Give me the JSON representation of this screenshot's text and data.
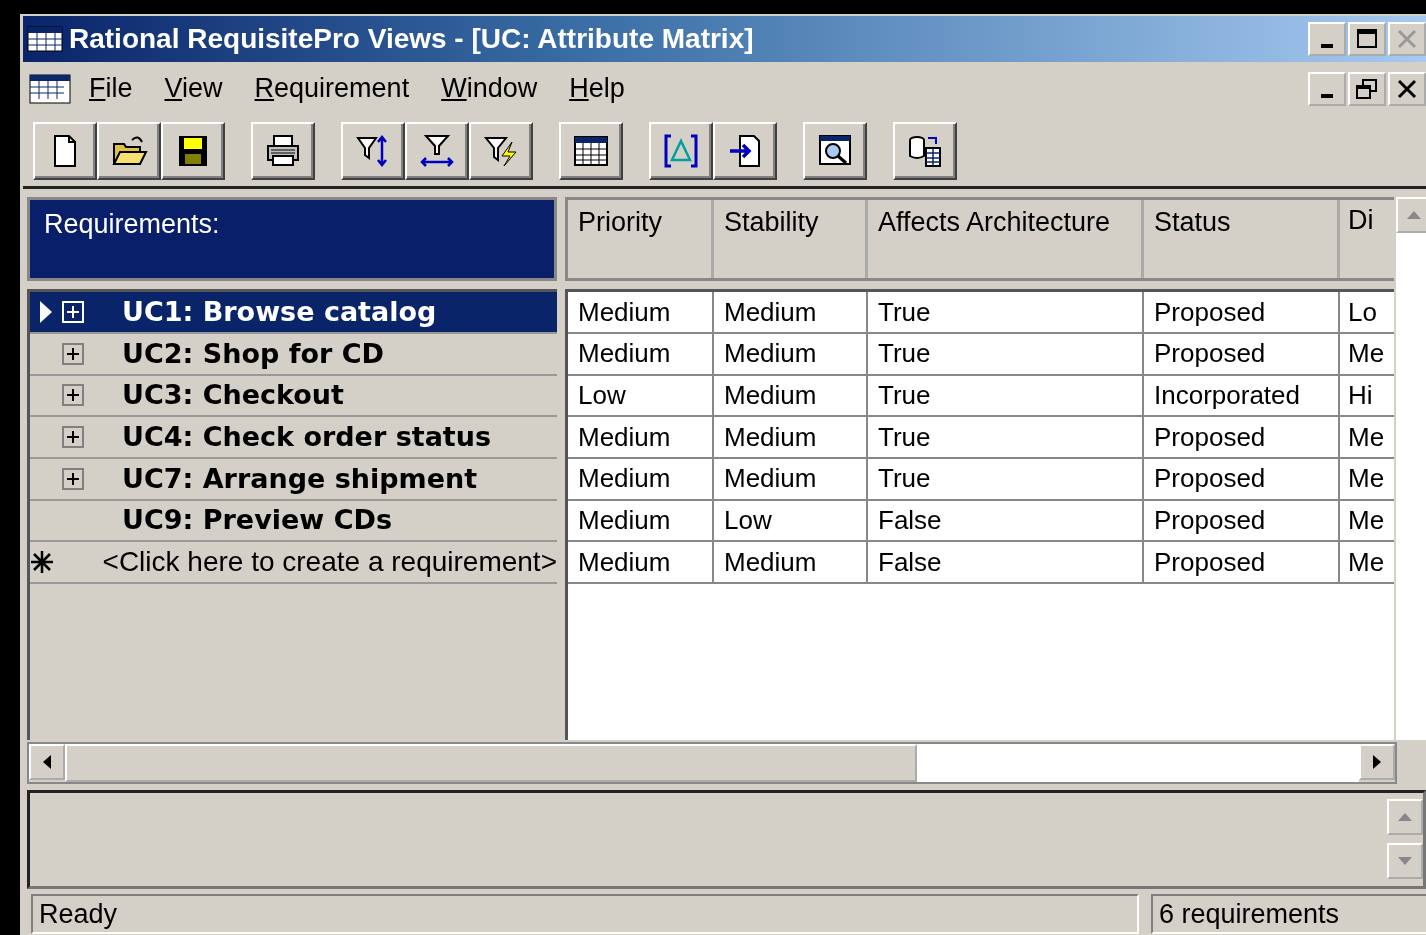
{
  "window": {
    "title": "Rational RequisitePro Views - [UC: Attribute Matrix]"
  },
  "menu": [
    "File",
    "View",
    "Requirement",
    "Window",
    "Help"
  ],
  "requirements_header": "Requirements:",
  "columns": [
    "Priority",
    "Stability",
    "Affects Architecture",
    "Status",
    "Di"
  ],
  "rows": [
    {
      "kind": "requirement",
      "label": "UC1: Browse catalog",
      "expandable": true,
      "selected": true,
      "cells": [
        "Medium",
        "Medium",
        "True",
        "Proposed",
        "Lo"
      ]
    },
    {
      "kind": "requirement",
      "label": "UC2: Shop for CD",
      "expandable": true,
      "selected": false,
      "cells": [
        "Medium",
        "Medium",
        "True",
        "Proposed",
        "Me"
      ]
    },
    {
      "kind": "requirement",
      "label": "UC3: Checkout",
      "expandable": true,
      "selected": false,
      "cells": [
        "Low",
        "Medium",
        "True",
        "Incorporated",
        "Hi"
      ]
    },
    {
      "kind": "requirement",
      "label": "UC4: Check order status",
      "expandable": true,
      "selected": false,
      "cells": [
        "Medium",
        "Medium",
        "True",
        "Proposed",
        "Me"
      ]
    },
    {
      "kind": "requirement",
      "label": "UC7: Arrange shipment",
      "expandable": true,
      "selected": false,
      "cells": [
        "Medium",
        "Medium",
        "True",
        "Proposed",
        "Me"
      ]
    },
    {
      "kind": "requirement",
      "label": "UC9: Preview CDs",
      "expandable": false,
      "selected": false,
      "cells": [
        "Medium",
        "Low",
        "False",
        "Proposed",
        "Me"
      ]
    },
    {
      "kind": "new",
      "label": "<Click here to create a requirement>",
      "selected": false,
      "cells": [
        "Medium",
        "Medium",
        "False",
        "Proposed",
        "Me"
      ]
    }
  ],
  "status_bar": [
    "Ready",
    "6 requirements"
  ]
}
